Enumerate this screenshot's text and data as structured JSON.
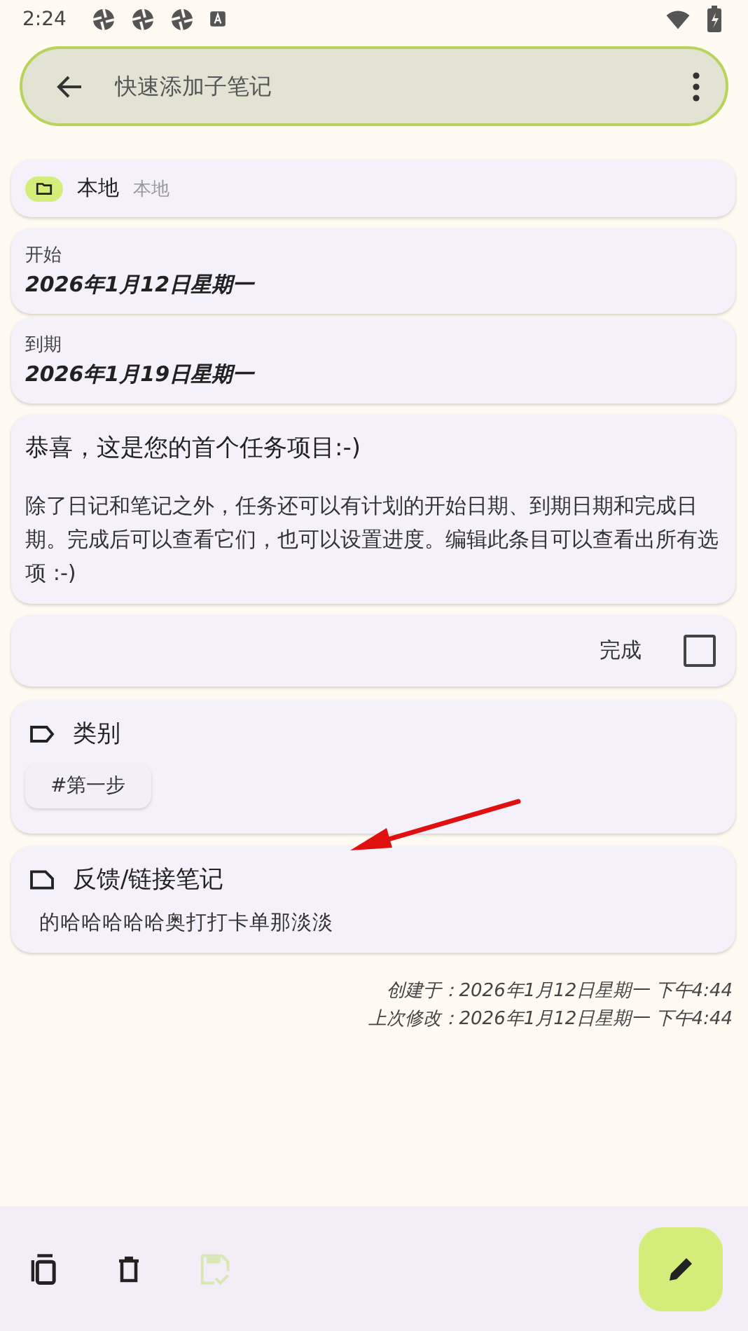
{
  "status_bar": {
    "time": "2:24",
    "notifications": [
      {
        "kind": "app"
      },
      {
        "kind": "app"
      },
      {
        "kind": "app"
      },
      {
        "kind": "keyboard"
      }
    ]
  },
  "search_bar": {
    "placeholder": "快速添加子笔记"
  },
  "collection": {
    "name": "本地",
    "account": "本地"
  },
  "dates": [
    {
      "label": "开始",
      "value": "2026年1月12日星期一"
    },
    {
      "label": "到期",
      "value": "2026年1月19日星期一"
    }
  ],
  "description": {
    "title": "恭喜，这是您的首个任务项目:-)",
    "body": "除了日记和笔记之外，任务还可以有计划的开始日期、到期日期和完成日期。完成后可以查看它们，也可以设置进度。编辑此条目可以查看出所有选项 :-)"
  },
  "completion": {
    "label": "完成",
    "checked": false
  },
  "categories": {
    "title": "类别",
    "tags": [
      "#第一步"
    ]
  },
  "feedback": {
    "title": "反馈/链接笔记",
    "items": [
      "的哈哈哈哈哈奥打打卡单那淡淡"
    ]
  },
  "meta": [
    "创建于：2026年1月12日星期一 下午4:44",
    "上次修改：2026年1月12日星期一 下午4:44"
  ],
  "annotation": {
    "kind": "arrow"
  },
  "bottom_bar": {
    "actions": [
      {
        "kind": "copy",
        "disabled": false
      },
      {
        "kind": "delete",
        "disabled": false
      },
      {
        "kind": "save",
        "disabled": true
      }
    ],
    "fab": {
      "kind": "edit"
    }
  }
}
